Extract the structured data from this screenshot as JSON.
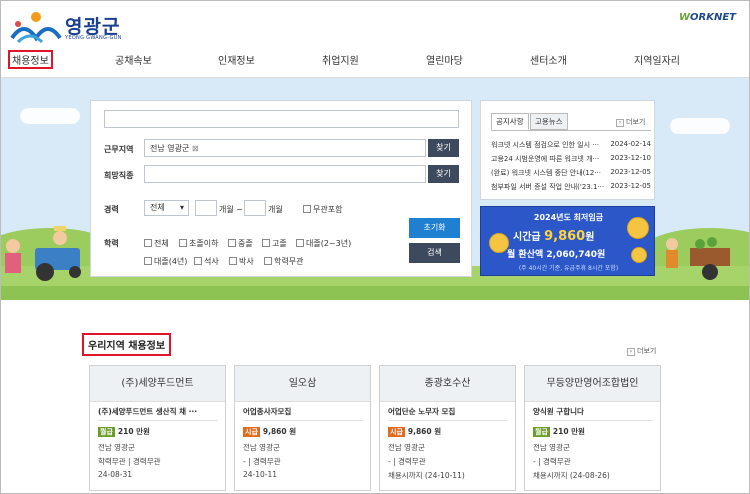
{
  "header": {
    "logo_text": "영광군",
    "logo_sub": "YEONG GWANG-GUN",
    "partner_logo_w": "W",
    "partner_logo": "ORKNET"
  },
  "nav": [
    "채용정보",
    "공채속보",
    "인재정보",
    "취업지원",
    "열린마당",
    "센터소개",
    "지역일자리"
  ],
  "search": {
    "region_label": "근무지역",
    "region_value": "전남 영광군",
    "region_remove": "⊠",
    "find_label": "찾기",
    "job_label": "희망직종",
    "career_label": "경력",
    "career_select": "전체",
    "career_select_arrow": "▾",
    "month_tilde": "개월 ~",
    "month_end": "개월",
    "no_career": "무관포함",
    "edu_label": "학력",
    "edu_options_row1": [
      "전체",
      "초졸이하",
      "중졸",
      "고졸",
      "대졸(2~3년)"
    ],
    "edu_options_row2": [
      "대졸(4년)",
      "석사",
      "박사",
      "학력무관"
    ],
    "reset_label": "초기화",
    "search_label": "검색"
  },
  "notice": {
    "tabs": [
      "공지사항",
      "고용뉴스"
    ],
    "more_arrow": "›",
    "more_label": "더보기",
    "items": [
      {
        "title": "워크넷 시스템 점검으로 인한 일시 ···",
        "date": "2024-02-14"
      },
      {
        "title": "고용24 시범운영에 따른 워크넷 개···",
        "date": "2023-12-10"
      },
      {
        "title": "(완료) 워크넷 시스템 중단 안내(12···",
        "date": "2023-12-05"
      },
      {
        "title": "첨부파일 서버 증설 작업 안내('23.1···",
        "date": "2023-12-05"
      }
    ]
  },
  "wage_banner": {
    "title": "2024년도 최저임금",
    "hourly_prefix": "시간급",
    "hourly_value": "9,860",
    "hourly_unit": "원",
    "monthly": "월 환산액 2,060,740원",
    "note": "(주 40시간 기준, 유급주휴 8시간 포함)"
  },
  "section": {
    "title": "우리지역 채용정보",
    "more_arrow": "›",
    "more_label": "더보기"
  },
  "cards": [
    {
      "company": "(주)세양푸드먼트",
      "job": "(주)세양푸드먼트 생산직 채 ···",
      "pay_type": "월급",
      "pay": "210 만원",
      "region": "전남 영광군",
      "cond": "학력무관 | 경력무관",
      "date": "24-08-31"
    },
    {
      "company": "일오삼",
      "job": "어업종사자모집",
      "pay_type": "시급",
      "pay": "9,860 원",
      "region": "전남 영광군",
      "cond": "- | 경력무관",
      "date": "24-10-11"
    },
    {
      "company": "종광호수산",
      "job": "어업단순 노무자 모집",
      "pay_type": "시급",
      "pay": "9,860 원",
      "region": "전남 영광군",
      "cond": "- | 경력무관",
      "date": "채용시까지 (24-10-11)"
    },
    {
      "company": "무등양만영어조합법인",
      "job": "양식원 구합니다",
      "pay_type": "월급",
      "pay": "210 만원",
      "region": "전남 영광군",
      "cond": "- | 경력무관",
      "date": "채용시까지 (24-08-26)"
    }
  ],
  "colors": {
    "accent_red": "#e0142b",
    "button_blue": "#1f7fd0",
    "button_dark": "#3d4a5e",
    "pay_monthly": "#6a9c2a",
    "pay_hourly": "#e06a1e"
  }
}
